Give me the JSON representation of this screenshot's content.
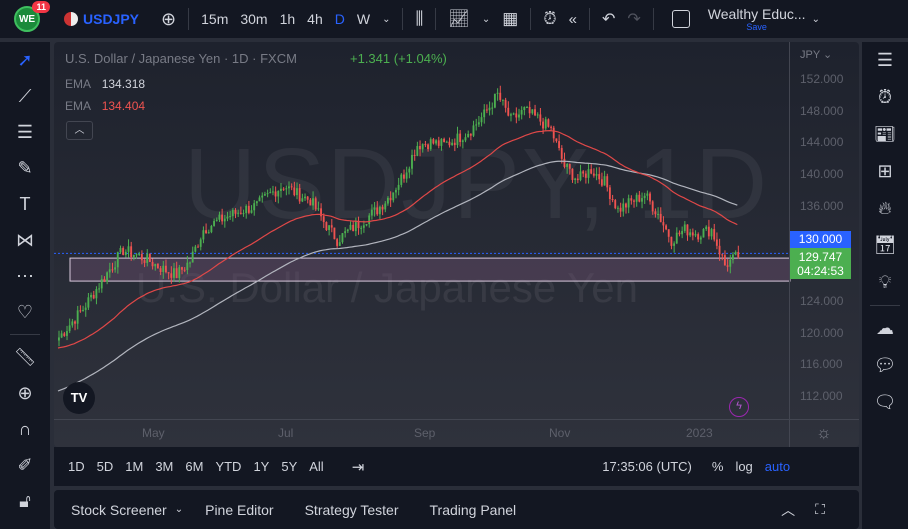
{
  "topbar": {
    "badge": "11",
    "logo": "WE",
    "symbol": "USDJPY",
    "intervals": [
      "15m",
      "30m",
      "1h",
      "4h",
      "D",
      "W"
    ],
    "active_interval": "D",
    "layout_name": "Wealthy Educ...",
    "save_label": "Save"
  },
  "legend": {
    "title": "U.S. Dollar / Japanese Yen · 1D · FXCM",
    "change": "+1.341 (+1.04%)",
    "ema1_label": "EMA",
    "ema1_value": "134.318",
    "ema2_label": "EMA",
    "ema2_value": "134.404"
  },
  "watermark": {
    "symbol": "USDJPY, 1D",
    "name": "U.S. Dollar / Japanese Yen"
  },
  "price_axis": {
    "currency": "JPY",
    "ticks": [
      "152.000",
      "148.000",
      "144.000",
      "140.000",
      "136.000",
      "124.000",
      "120.000",
      "116.000",
      "112.000"
    ],
    "alert_price": "130.000",
    "last_price": "129.747",
    "countdown": "04:24:53"
  },
  "time_axis": {
    "ticks": [
      "May",
      "Jul",
      "Sep",
      "Nov",
      "2023"
    ]
  },
  "bottom_bar": {
    "ranges": [
      "1D",
      "5D",
      "1M",
      "3M",
      "6M",
      "YTD",
      "1Y",
      "5Y",
      "All"
    ],
    "clock": "17:35:06 (UTC)",
    "percent": "%",
    "log": "log",
    "auto": "auto"
  },
  "panel": {
    "tabs": [
      "Stock Screener",
      "Pine Editor",
      "Strategy Tester",
      "Trading Panel"
    ]
  },
  "colors": {
    "up": "#26a69a",
    "green": "#4caf50",
    "down": "#ef5350",
    "accent": "#2962ff",
    "ema_fast": "#e04848",
    "ema_slow": "#b2b5be",
    "zone": "#6b4f6e"
  },
  "chart_data": {
    "type": "candlestick",
    "title": "USDJPY, 1D",
    "ylabel": "JPY",
    "ylim": [
      110,
      154
    ],
    "weekly_closes": [
      119,
      121,
      123,
      125.5,
      128,
      130.4,
      129.8,
      129,
      128,
      127.3,
      129,
      133,
      134,
      134.8,
      135.5,
      136,
      137.5,
      138.6,
      137.5,
      136.7,
      134,
      131.7,
      133,
      134.2,
      135.5,
      137.4,
      140,
      143.7,
      144,
      143.7,
      144.5,
      145.6,
      147.5,
      150,
      146.8,
      148,
      147,
      145.6,
      141,
      139.3,
      140.6,
      139,
      135.5,
      136.5,
      137.4,
      135,
      131.7,
      133,
      132.5,
      133,
      128.5,
      129.7
    ],
    "support_zone": [
      126.5,
      129.4
    ],
    "alert_line": 130.0
  }
}
